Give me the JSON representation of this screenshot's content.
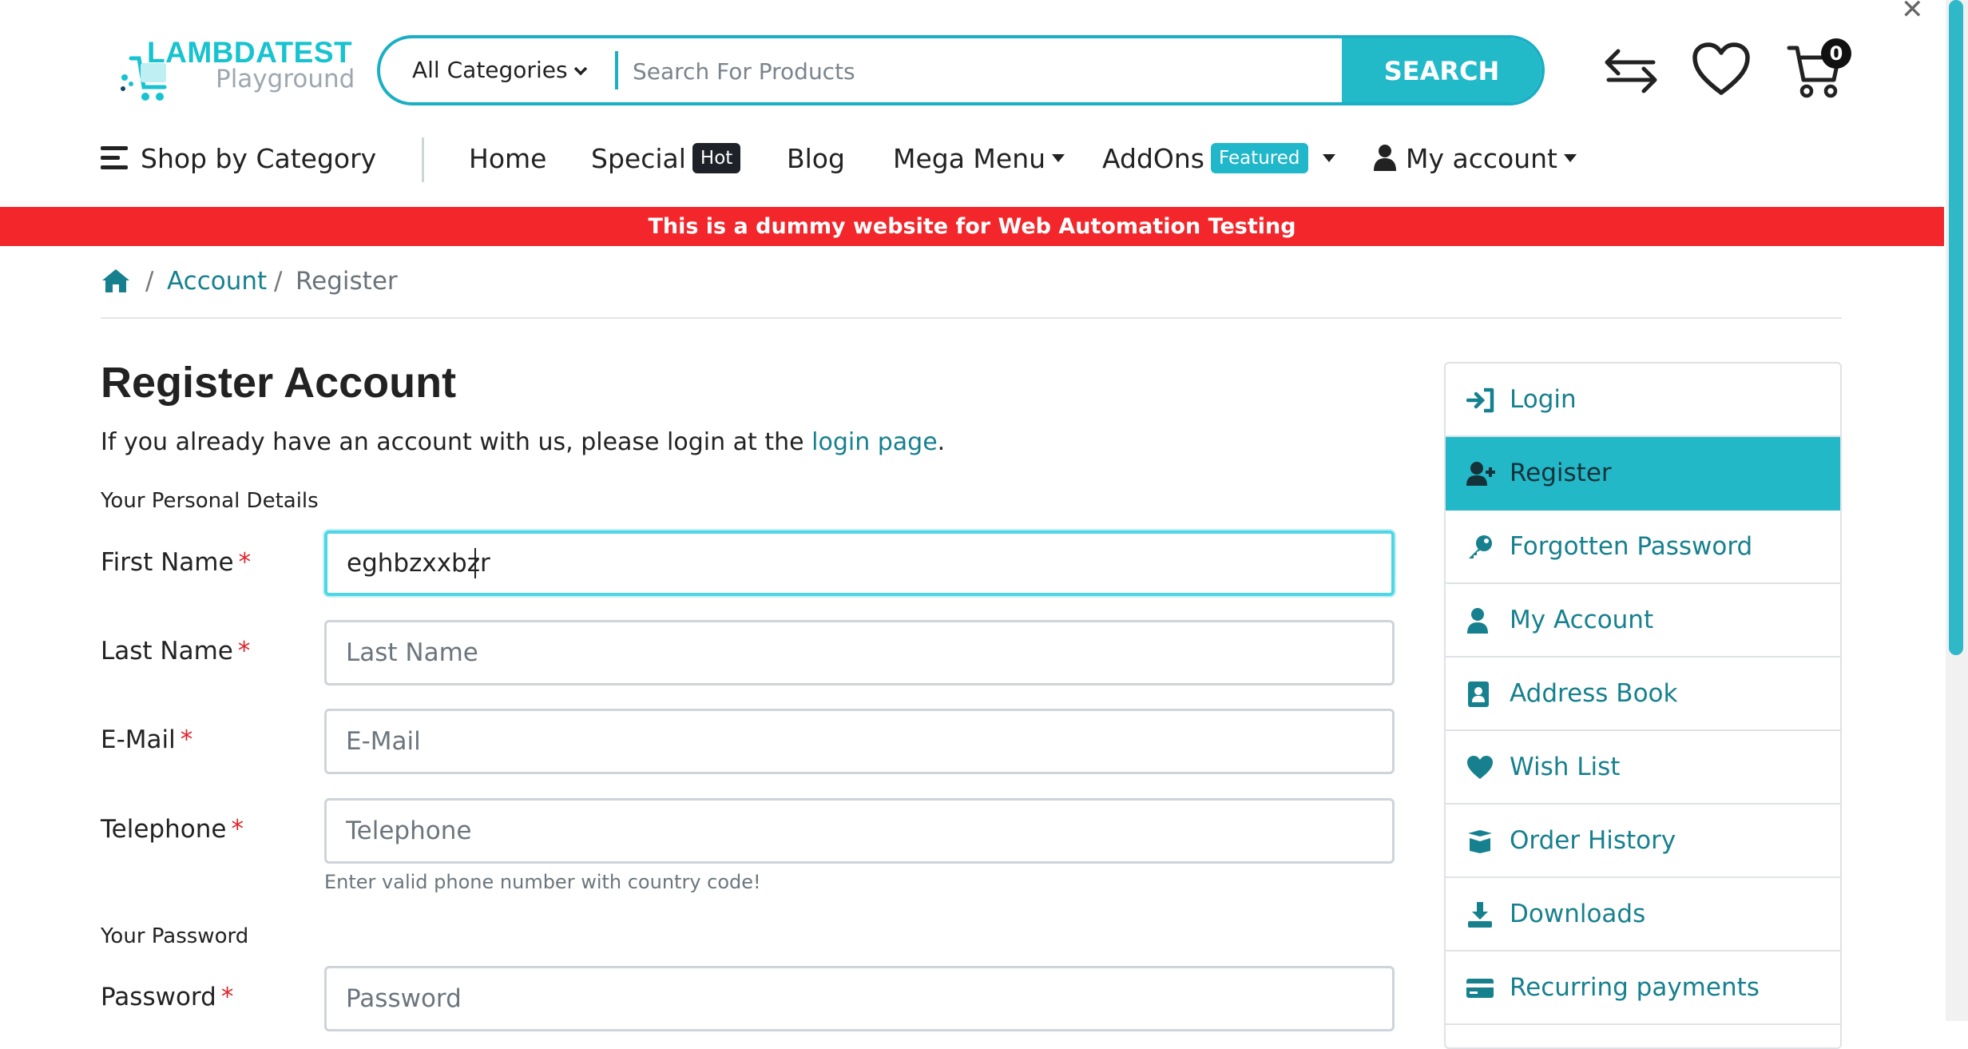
{
  "header": {
    "logo": {
      "title": "LAMBDATEST",
      "subtitle": "Playground"
    },
    "search": {
      "category_label": "All Categories",
      "placeholder": "Search For Products",
      "button_label": "SEARCH"
    },
    "cart_count": "0"
  },
  "nav": {
    "shop_by_category": "Shop by Category",
    "home": "Home",
    "special": "Special",
    "special_badge": "Hot",
    "blog": "Blog",
    "mega_menu": "Mega Menu",
    "addons": "AddOns",
    "addons_badge": "Featured",
    "my_account": "My account"
  },
  "banner": "This is a dummy website for Web Automation Testing",
  "breadcrumb": {
    "sep": "/",
    "account": "Account",
    "current": "Register"
  },
  "page": {
    "title": "Register Account",
    "intro_prefix": "If you already have an account with us, please login at the ",
    "intro_link": "login page",
    "intro_suffix": ".",
    "personal_legend": "Your Personal Details",
    "password_legend": "Your Password",
    "required_mark": "*",
    "fields": {
      "first_name": {
        "label": "First Name",
        "value": "eghbzxxbzr",
        "placeholder": "First Name"
      },
      "last_name": {
        "label": "Last Name",
        "value": "",
        "placeholder": "Last Name"
      },
      "email": {
        "label": "E-Mail",
        "value": "",
        "placeholder": "E-Mail"
      },
      "telephone": {
        "label": "Telephone",
        "value": "",
        "placeholder": "Telephone",
        "help": "Enter valid phone number with country code!"
      },
      "password": {
        "label": "Password",
        "value": "",
        "placeholder": "Password"
      }
    }
  },
  "sidebar": {
    "items": [
      {
        "label": "Login",
        "icon": "sign-in-icon"
      },
      {
        "label": "Register",
        "icon": "user-plus-icon",
        "active": true
      },
      {
        "label": "Forgotten Password",
        "icon": "key-icon"
      },
      {
        "label": "My Account",
        "icon": "user-icon"
      },
      {
        "label": "Address Book",
        "icon": "address-book-icon"
      },
      {
        "label": "Wish List",
        "icon": "heart-icon"
      },
      {
        "label": "Order History",
        "icon": "box-open-icon"
      },
      {
        "label": "Downloads",
        "icon": "download-icon"
      },
      {
        "label": "Recurring payments",
        "icon": "credit-card-icon"
      }
    ]
  },
  "colors": {
    "accent": "#22b8c8",
    "link": "#17808e",
    "banner": "#f2262b",
    "required": "#e0222a"
  }
}
